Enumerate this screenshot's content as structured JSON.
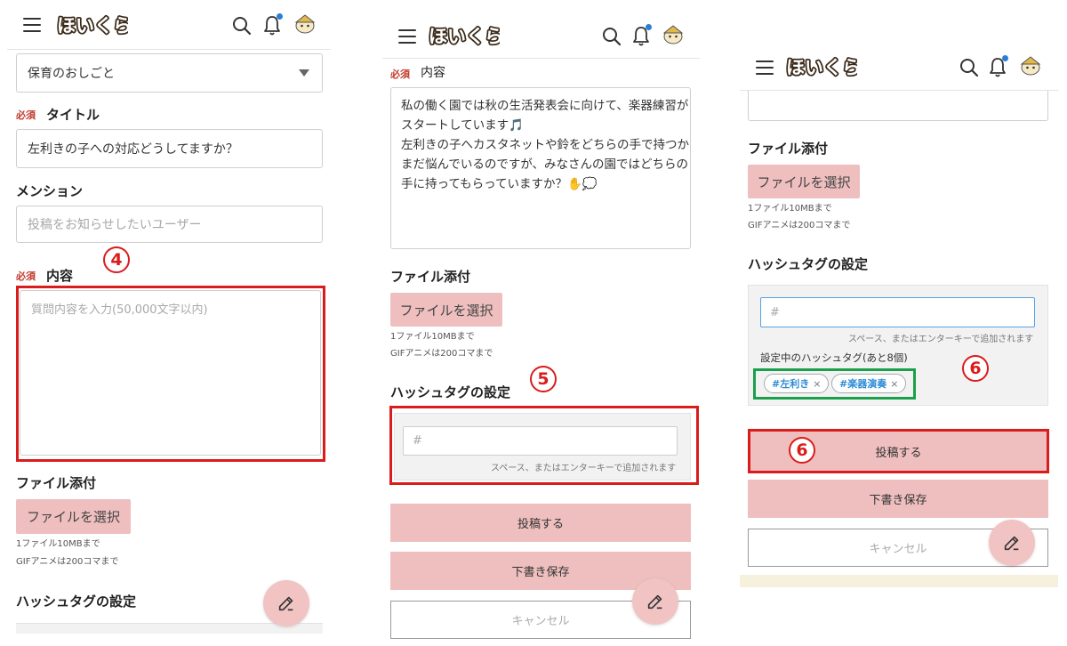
{
  "header": {
    "logo_text": "ほいくらうんじ"
  },
  "form": {
    "category_value": "保育のおしごと",
    "required_badge": "必須",
    "title_label": "タイトル",
    "title_value": "左利きの子への対応どうしてますか？",
    "mention_label": "メンション",
    "mention_placeholder": "投稿をお知らせしたいユーザー",
    "content_label": "内容",
    "content_placeholder": "質問内容を入力(50,000文字以内)",
    "content_lines": [
      "私の働く園では秋の生活発表会に向けて、楽器練習が",
      "スタートしています🎵",
      "左利きの子へカスタネットや鈴をどちらの手で持つか",
      "まだ悩んでいるのですが、みなさんの園ではどちらの",
      "手に持ってもらっていますか？✋💭"
    ],
    "file_label": "ファイル添付",
    "file_button": "ファイルを選択",
    "file_note_1": "1ファイル10MBまで",
    "file_note_2": "GIFアニメは200コマまで",
    "hashtag_label": "ハッシュタグの設定",
    "hashtag_placeholder": "#",
    "hashtag_note": "スペース、またはエンターキーで追加されます",
    "hashtag_current_label": "設定中のハッシュタグ(あと8個)",
    "tags": [
      "#左利き",
      "#楽器演奏"
    ],
    "tag_remove": "×",
    "submit_button": "投稿する",
    "draft_button": "下書き保存",
    "cancel_button": "キャンセル"
  },
  "annotations": {
    "step4": "4",
    "step5": "5",
    "step6": "6"
  },
  "colors": {
    "accent_pink": "#efbfbf",
    "highlight_red": "#d91c1c",
    "highlight_green": "#1aa04a",
    "tag_text": "#2d8bd6",
    "notification_dot": "#2a7fd4"
  }
}
